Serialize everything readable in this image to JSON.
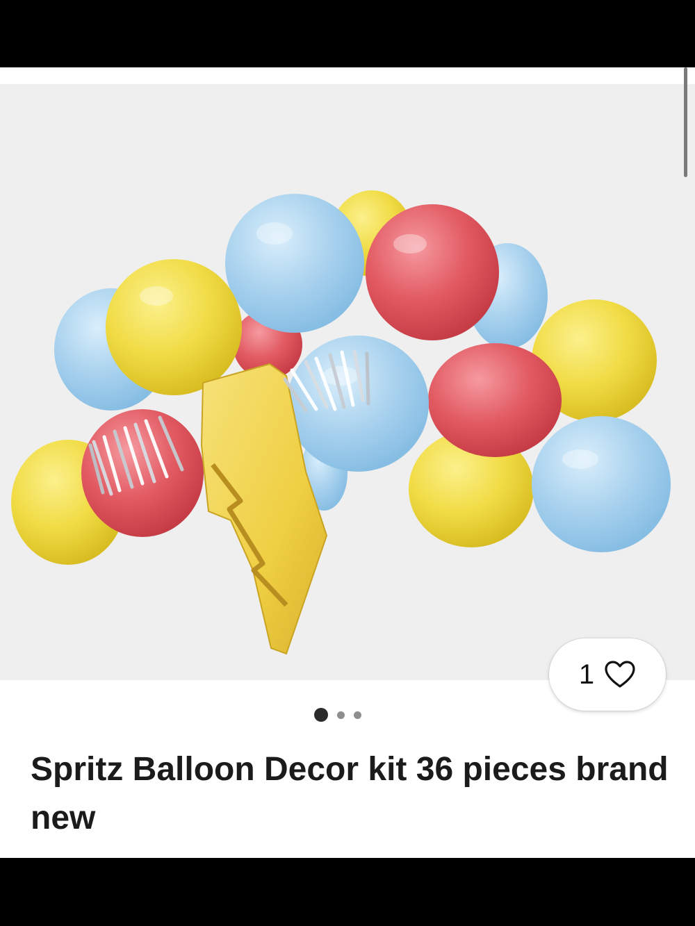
{
  "listing": {
    "title": "Spritz Balloon Decor kit 36 pieces brand new",
    "photo_description_icon": "balloon-garland-photo",
    "like_count": "1",
    "image_count": 3,
    "active_image": 1
  },
  "colors": {
    "balloon_blue": "#a9d2ee",
    "balloon_yellow": "#f1dc45",
    "balloon_red": "#e25a62",
    "lightning_gold": "#efcf43",
    "tassel_silver": "#c9ced4"
  },
  "icons": {
    "like": "heart-icon"
  }
}
